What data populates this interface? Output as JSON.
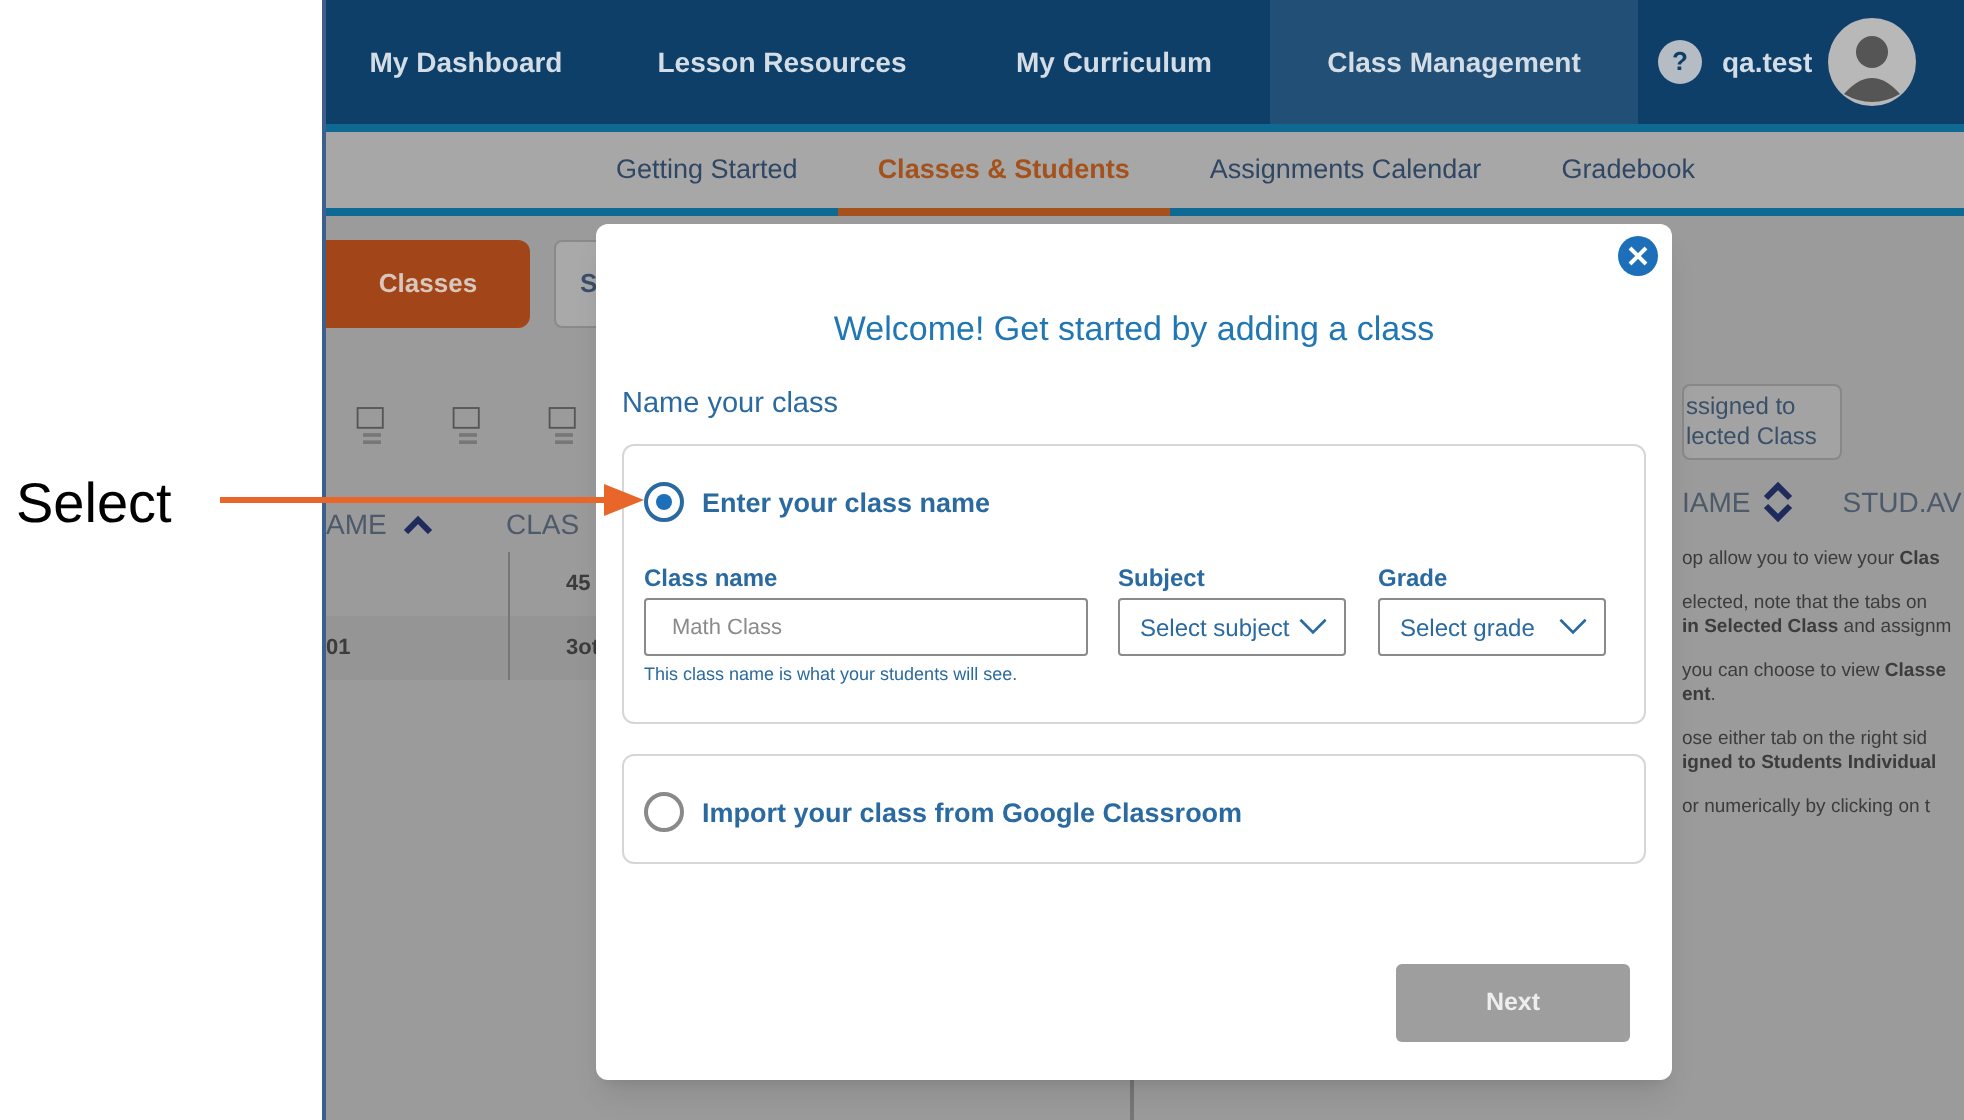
{
  "annotation": {
    "label": "Select"
  },
  "nav": {
    "items": [
      {
        "label": "My Dashboard",
        "selected": false
      },
      {
        "label": "Lesson Resources",
        "selected": false
      },
      {
        "label": "My Curriculum",
        "selected": false
      },
      {
        "label": "Class Management",
        "selected": true
      }
    ],
    "help": "?",
    "user": "qa.test"
  },
  "subnav": [
    {
      "label": "Getting Started",
      "selected": false
    },
    {
      "label": "Classes & Students",
      "selected": true
    },
    {
      "label": "Assignments Calendar",
      "selected": false
    },
    {
      "label": "Gradebook",
      "selected": false
    }
  ],
  "view_tabs": [
    {
      "label": "Classes",
      "selected": true
    },
    {
      "label": "S",
      "selected": false
    }
  ],
  "left_table": {
    "columns": [
      "AME",
      "CLAS"
    ],
    "rows": [
      [
        "",
        "45"
      ],
      [
        "01",
        "3ot"
      ]
    ]
  },
  "right_panel": {
    "button_lines": [
      "ssigned to",
      "lected Class"
    ],
    "columns": [
      "IAME",
      "STUD.AV"
    ],
    "paragraphs": [
      [
        "op allow you to view your **Clas**"
      ],
      [
        "elected, note that the tabs on",
        "**in Selected Class** and assignm"
      ],
      [
        "you can choose to view **Classe**",
        "**ent**."
      ],
      [
        "ose either tab on the right sid",
        "**igned to Students Individual**"
      ],
      [
        "or numerically by clicking on t"
      ]
    ]
  },
  "modal": {
    "title": "Welcome! Get started by adding a class",
    "section": "Name your class",
    "options": [
      {
        "kind": "form",
        "label": "Enter your class name",
        "selected": true
      },
      {
        "kind": "plain",
        "label": "Import your class from Google Classroom",
        "selected": false
      }
    ],
    "class_name": {
      "label": "Class name",
      "placeholder": "Math Class",
      "hint": "This class name is what your students will see."
    },
    "subject": {
      "label": "Subject",
      "value": "Select subject"
    },
    "grade": {
      "label": "Grade",
      "value": "Select grade"
    },
    "next": {
      "label": "Next",
      "disabled": true
    }
  }
}
